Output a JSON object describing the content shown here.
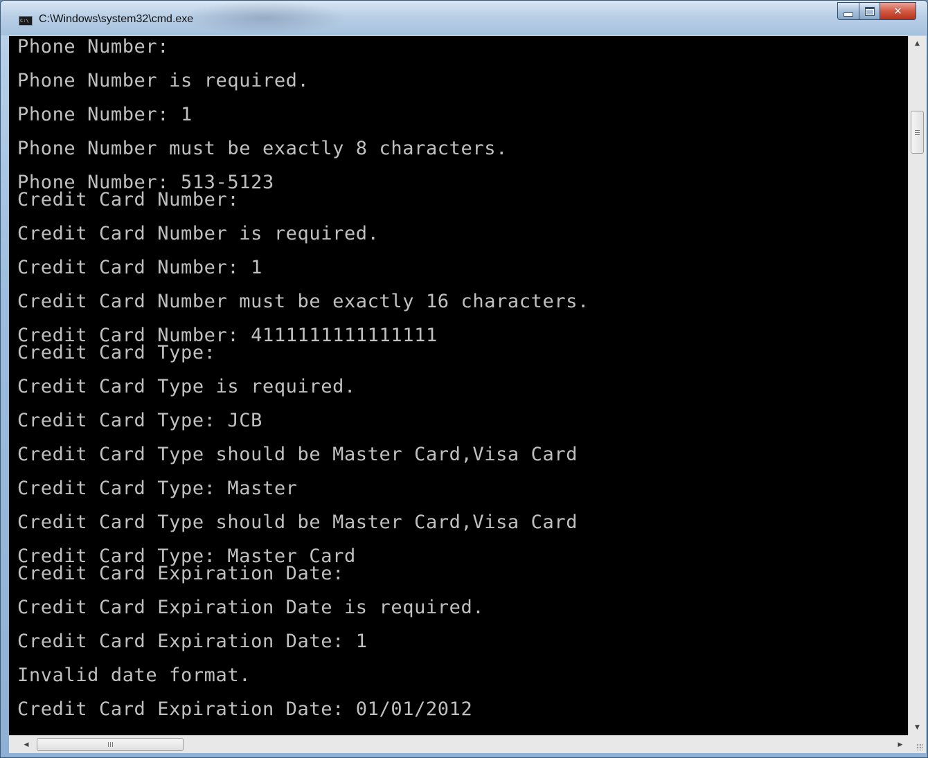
{
  "window": {
    "title": "C:\\Windows\\system32\\cmd.exe",
    "icon": "cmd-icon",
    "icon_text": "C:\\",
    "buttons": {
      "minimize_icon": "minimize-icon",
      "maximize_icon": "maximize-icon",
      "close_icon": "close-icon",
      "close_glyph": "✕"
    }
  },
  "console": {
    "background": "#000000",
    "foreground": "#c0c0c0",
    "lines": [
      "Phone Number:",
      "Phone Number is required.",
      "Phone Number: 1",
      "Phone Number must be exactly 8 characters.",
      "Phone Number: 513-5123",
      "Credit Card Number:",
      "Credit Card Number is required.",
      "Credit Card Number: 1",
      "Credit Card Number must be exactly 16 characters.",
      "Credit Card Number: 4111111111111111",
      "Credit Card Type:",
      "Credit Card Type is required.",
      "Credit Card Type: JCB",
      "Credit Card Type should be Master Card,Visa Card",
      "Credit Card Type: Master",
      "Credit Card Type should be Master Card,Visa Card",
      "Credit Card Type: Master Card",
      "Credit Card Expiration Date:",
      "Credit Card Expiration Date is required.",
      "Credit Card Expiration Date: 1",
      "Invalid date format.",
      "Credit Card Expiration Date: 01/01/2012"
    ]
  },
  "scrollbars": {
    "vertical": {
      "up_glyph": "▲",
      "down_glyph": "▼"
    },
    "horizontal": {
      "left_glyph": "◀",
      "right_glyph": "▶"
    }
  }
}
